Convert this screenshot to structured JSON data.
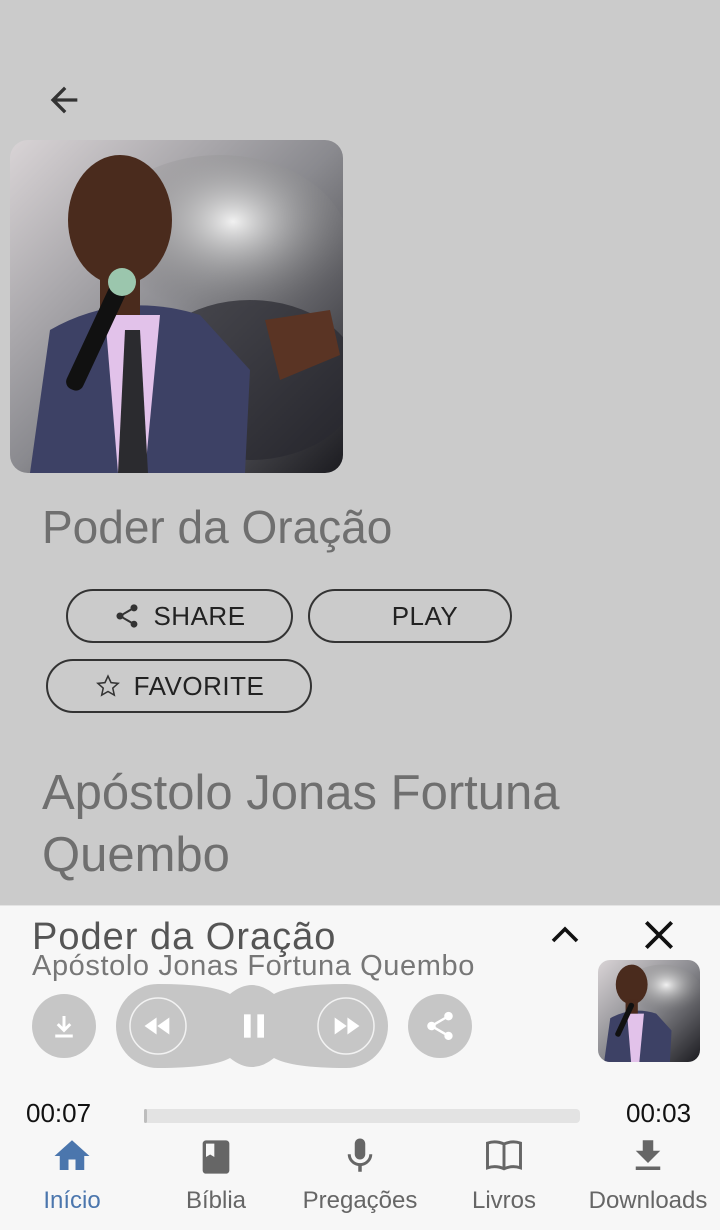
{
  "header": {
    "back_icon": "arrow-left-icon"
  },
  "podcast": {
    "title": "Poder da Oração",
    "artist": "Apóstolo Jonas Fortuna Quembo"
  },
  "actions": {
    "share_label": "SHARE",
    "play_label": "PLAY",
    "favorite_label": "FAVORITE"
  },
  "player": {
    "title": "Poder da Oração",
    "artist": "Apóstolo Jonas Fortuna Quembo",
    "elapsed": "00:07",
    "remaining": "00:03",
    "progress_fraction": 0.006,
    "state": "playing"
  },
  "bottom_nav": {
    "items": [
      {
        "label": "Início",
        "icon": "home-icon",
        "active": true
      },
      {
        "label": "Bíblia",
        "icon": "book-icon",
        "active": false
      },
      {
        "label": "Pregações",
        "icon": "microphone-icon",
        "active": false
      },
      {
        "label": "Livros",
        "icon": "open-book-icon",
        "active": false
      },
      {
        "label": "Downloads",
        "icon": "download-icon",
        "active": false
      }
    ]
  },
  "colors": {
    "background": "#cbcbcb",
    "panel": "#f7f7f7",
    "accent": "#4b76ad",
    "control_gray": "#c6c6c6"
  }
}
